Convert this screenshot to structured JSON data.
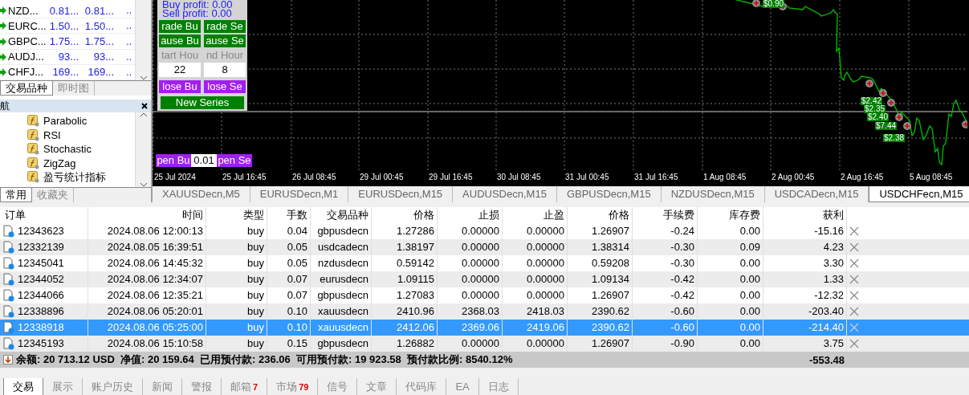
{
  "market_watch": {
    "rows": [
      {
        "symbol": "NZD...",
        "bid": "0.81...",
        "ask": "0.81...",
        "spread": ".."
      },
      {
        "symbol": "EURC...",
        "bid": "1.50...",
        "ask": "1.50...",
        "spread": ".."
      },
      {
        "symbol": "GBPC...",
        "bid": "1.75...",
        "ask": "1.75...",
        "spread": ".."
      },
      {
        "symbol": "AUDJ...",
        "bid": "93...",
        "ask": "93...",
        "spread": ".."
      },
      {
        "symbol": "CHFJ...",
        "bid": "169...",
        "ask": "169...",
        "spread": ".."
      }
    ],
    "tabs": [
      {
        "label": "交易品种",
        "selected": true
      },
      {
        "label": "即时图",
        "selected": false
      }
    ]
  },
  "navigator": {
    "title": "航",
    "items": [
      "Parabolic",
      "RSI",
      "Stochastic",
      "ZigZag",
      "盈亏统计指标"
    ],
    "tabs": [
      {
        "label": "常用",
        "selected": true
      },
      {
        "label": "收藏夹",
        "selected": false
      }
    ]
  },
  "chart": {
    "ea_panel": {
      "buy_profit": "Buy profit: 0.00",
      "sell_profit": "Sell profit: 0.00",
      "buttons": [
        {
          "label": "rade Bu",
          "kind": "green"
        },
        {
          "label": "rade Se",
          "kind": "green"
        },
        {
          "label": "ause Bu",
          "kind": "green"
        },
        {
          "label": "ause Se",
          "kind": "green"
        }
      ],
      "hour_labels": [
        "tart Hou",
        "nd Hour"
      ],
      "hour_values": [
        "22",
        "8"
      ],
      "close_buttons": [
        "lose Bu",
        "lose Se"
      ],
      "new_series": "New Series"
    },
    "order_bar": {
      "buy": "pen Bu",
      "lots": "0.01",
      "sell": "pen Se"
    },
    "trade_labels": [
      "$0.90",
      "$2.42",
      "$2.35",
      "$2.40",
      "$7.44",
      "$2.38"
    ],
    "time_axis": [
      "25 Jul 2024",
      "25 Jul 16:45",
      "26 Jul 08:45",
      "29 Jul 00:45",
      "29 Jul 16:45",
      "30 Jul 08:45",
      "31 Jul 00:45",
      "31 Jul 16:45",
      "1 Aug 08:45",
      "2 Aug 00:45",
      "2 Aug 16:45",
      "5 Aug 08:45"
    ],
    "tabs": [
      {
        "label": "XAUUSDecn,M5",
        "selected": false
      },
      {
        "label": "EURUSDecn,M1",
        "selected": false
      },
      {
        "label": "EURUSDecn,M15",
        "selected": false
      },
      {
        "label": "AUDUSDecn,M15",
        "selected": false
      },
      {
        "label": "GBPUSDecn,M15",
        "selected": false
      },
      {
        "label": "NZDUSDecn,M15",
        "selected": false
      },
      {
        "label": "USDCADecn,M15",
        "selected": false
      },
      {
        "label": "USDCHFecn,M15",
        "selected": true
      }
    ]
  },
  "table": {
    "columns": [
      "订单",
      "时间",
      "类型",
      "手数",
      "交易品种",
      "价格",
      "止损",
      "止盈",
      "价格",
      "手续费",
      "库存费",
      "获利"
    ],
    "rows": [
      {
        "cells": [
          "12343623",
          "2024.08.06 12:00:13",
          "buy",
          "0.04",
          "gbpusdecn",
          "1.27286",
          "0.00000",
          "0.00000",
          "1.26907",
          "-0.24",
          "0.00",
          "-15.16"
        ],
        "selected": false
      },
      {
        "cells": [
          "12332139",
          "2024.08.05 16:39:51",
          "buy",
          "0.05",
          "usdcadecn",
          "1.38197",
          "0.00000",
          "0.00000",
          "1.38314",
          "-0.30",
          "0.09",
          "4.23"
        ],
        "selected": false
      },
      {
        "cells": [
          "12345041",
          "2024.08.06 14:45:32",
          "buy",
          "0.05",
          "nzdusdecn",
          "0.59142",
          "0.00000",
          "0.00000",
          "0.59208",
          "-0.30",
          "0.00",
          "3.30"
        ],
        "selected": false
      },
      {
        "cells": [
          "12344052",
          "2024.08.06 12:34:07",
          "buy",
          "0.07",
          "eurusdecn",
          "1.09115",
          "0.00000",
          "0.00000",
          "1.09134",
          "-0.42",
          "0.00",
          "1.33"
        ],
        "selected": false
      },
      {
        "cells": [
          "12344066",
          "2024.08.06 12:35:21",
          "buy",
          "0.07",
          "gbpusdecn",
          "1.27083",
          "0.00000",
          "0.00000",
          "1.26907",
          "-0.42",
          "0.00",
          "-12.32"
        ],
        "selected": false
      },
      {
        "cells": [
          "12338896",
          "2024.08.06 05:20:01",
          "buy",
          "0.10",
          "xauusdecn",
          "2410.96",
          "2368.03",
          "2418.03",
          "2390.62",
          "-0.60",
          "0.00",
          "-203.40"
        ],
        "selected": false
      },
      {
        "cells": [
          "12338918",
          "2024.08.06 05:25:00",
          "buy",
          "0.10",
          "xauusdecn",
          "2412.06",
          "2369.06",
          "2419.06",
          "2390.62",
          "-0.60",
          "0.00",
          "-214.40"
        ],
        "selected": true
      },
      {
        "cells": [
          "12345193",
          "2024.08.06 15:10:58",
          "buy",
          "0.15",
          "gbpusdecn",
          "1.26882",
          "0.00000",
          "0.00000",
          "1.26907",
          "-0.90",
          "0.00",
          "3.75"
        ],
        "selected": false
      }
    ],
    "summary": {
      "text": "余额: 20 713.12 USD  净值: 20 159.64  已用预付款: 236.06  可用预付款: 19 923.58  预付款比例: 8540.12%",
      "profit": "-553.48"
    }
  },
  "bottom_tabs": [
    {
      "label": "交易",
      "selected": true
    },
    {
      "label": "展示",
      "selected": false
    },
    {
      "label": "账户历史",
      "selected": false
    },
    {
      "label": "新闻",
      "selected": false
    },
    {
      "label": "警报",
      "selected": false
    },
    {
      "label": "邮箱",
      "badge": "7",
      "selected": false
    },
    {
      "label": "市场",
      "badge": "79",
      "selected": false
    },
    {
      "label": "信号",
      "selected": false
    },
    {
      "label": "文章",
      "selected": false
    },
    {
      "label": "代码库",
      "selected": false
    },
    {
      "label": "EA",
      "selected": false
    },
    {
      "label": "日志",
      "selected": false
    }
  ]
}
